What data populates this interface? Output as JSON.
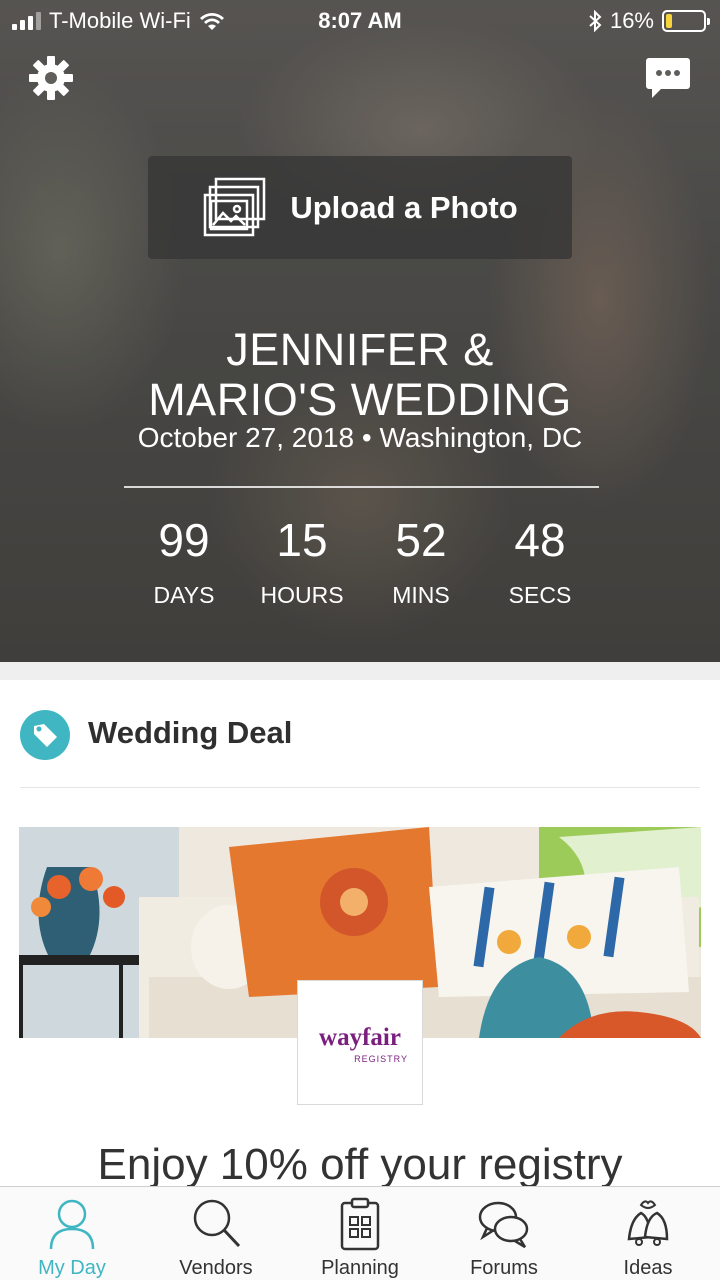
{
  "status_bar": {
    "carrier": "T-Mobile Wi-Fi",
    "time": "8:07 AM",
    "battery_percent": "16%",
    "battery_level": 0.16,
    "battery_color": "#f5d33a"
  },
  "hero": {
    "settings_icon": "gear-icon",
    "messages_icon": "chat-bubble-icon",
    "upload_label": "Upload a Photo",
    "names_line1": "JENNIFER &",
    "names_line2": "MARIO'S WEDDING",
    "date_location": "October 27, 2018 • Washington, DC",
    "countdown": [
      {
        "value": "99",
        "label": "DAYS"
      },
      {
        "value": "15",
        "label": "HOURS"
      },
      {
        "value": "52",
        "label": "MINS"
      },
      {
        "value": "48",
        "label": "SECS"
      }
    ]
  },
  "deal": {
    "icon": "tag-icon",
    "accent": "#3fb6c2",
    "title": "Wedding Deal",
    "brand_name": "wayfair",
    "brand_sub": "REGISTRY",
    "brand_color": "#7a1f7e",
    "promo_text": "Enjoy 10% off your registry"
  },
  "tabs": [
    {
      "label": "My Day",
      "icon": "person-icon",
      "active": true
    },
    {
      "label": "Vendors",
      "icon": "search-icon",
      "active": false
    },
    {
      "label": "Planning",
      "icon": "clipboard-icon",
      "active": false
    },
    {
      "label": "Forums",
      "icon": "chat-bubbles-icon",
      "active": false
    },
    {
      "label": "Ideas",
      "icon": "bells-icon",
      "active": false
    }
  ]
}
